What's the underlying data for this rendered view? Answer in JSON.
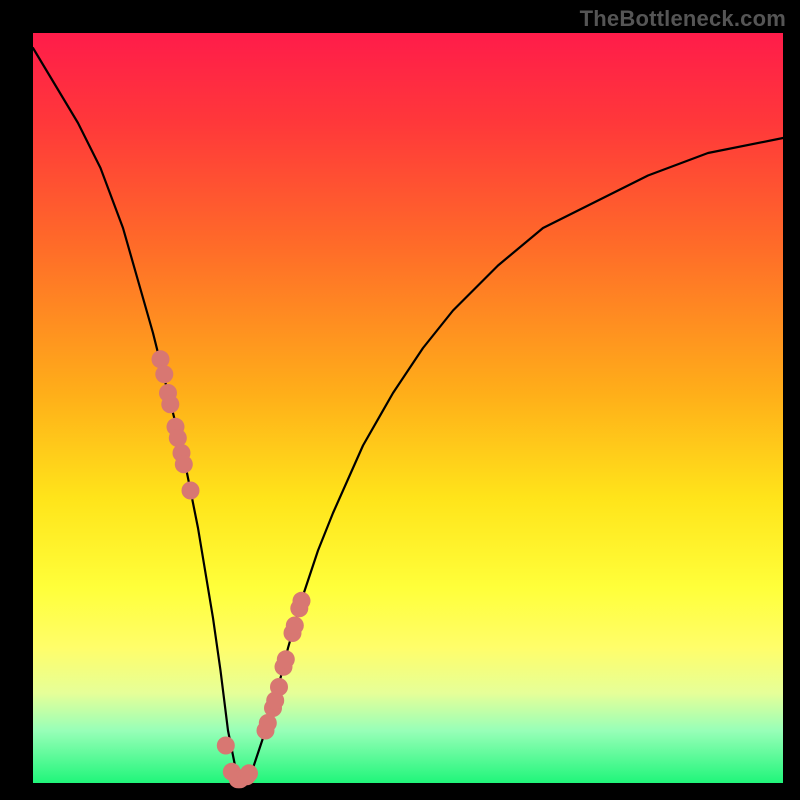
{
  "watermark": "TheBottleneck.com",
  "chart_data": {
    "type": "line",
    "title": "",
    "xlabel": "",
    "ylabel": "",
    "xlim": [
      0,
      100
    ],
    "ylim": [
      0,
      100
    ],
    "grid": false,
    "legend": false,
    "series": [
      {
        "name": "bottleneck-curve",
        "x": [
          0,
          3,
          6,
          9,
          12,
          14,
          16,
          18,
          20,
          22,
          23,
          24,
          25,
          26,
          27,
          28,
          29,
          30,
          32,
          34,
          36,
          38,
          40,
          44,
          48,
          52,
          56,
          62,
          68,
          74,
          82,
          90,
          100
        ],
        "y": [
          98,
          93,
          88,
          82,
          74,
          67,
          60,
          52,
          44,
          34,
          28,
          22,
          15,
          7,
          2,
          0,
          1,
          4,
          10,
          18,
          25,
          31,
          36,
          45,
          52,
          58,
          63,
          69,
          74,
          77,
          81,
          84,
          86
        ]
      }
    ],
    "markers": {
      "name": "highlighted-points",
      "color": "#d87772",
      "x": [
        17.0,
        17.5,
        18.0,
        18.3,
        19.0,
        19.3,
        19.8,
        20.1,
        21.0,
        25.7,
        26.5,
        27.3,
        27.6,
        28.5,
        28.8,
        31.0,
        31.3,
        32.0,
        32.3,
        32.8,
        33.4,
        33.7,
        34.6,
        34.9,
        35.5,
        35.8
      ],
      "y": [
        56.5,
        54.5,
        52.0,
        50.5,
        47.5,
        46.0,
        44.0,
        42.5,
        39.0,
        5.0,
        1.5,
        0.5,
        0.5,
        0.9,
        1.3,
        7.0,
        8.0,
        10.0,
        11.0,
        12.8,
        15.5,
        16.5,
        20.0,
        21.0,
        23.3,
        24.3
      ]
    },
    "background_gradient": {
      "direction": "top-to-bottom",
      "stops": [
        {
          "pct": 0,
          "color": "#ff1c4a"
        },
        {
          "pct": 12,
          "color": "#ff383a"
        },
        {
          "pct": 28,
          "color": "#ff6a29"
        },
        {
          "pct": 48,
          "color": "#ffae19"
        },
        {
          "pct": 62,
          "color": "#ffe41a"
        },
        {
          "pct": 74,
          "color": "#ffff3a"
        },
        {
          "pct": 82,
          "color": "#fffe6a"
        },
        {
          "pct": 88,
          "color": "#e6ff98"
        },
        {
          "pct": 93,
          "color": "#98ffb8"
        },
        {
          "pct": 100,
          "color": "#20f57a"
        }
      ]
    }
  }
}
